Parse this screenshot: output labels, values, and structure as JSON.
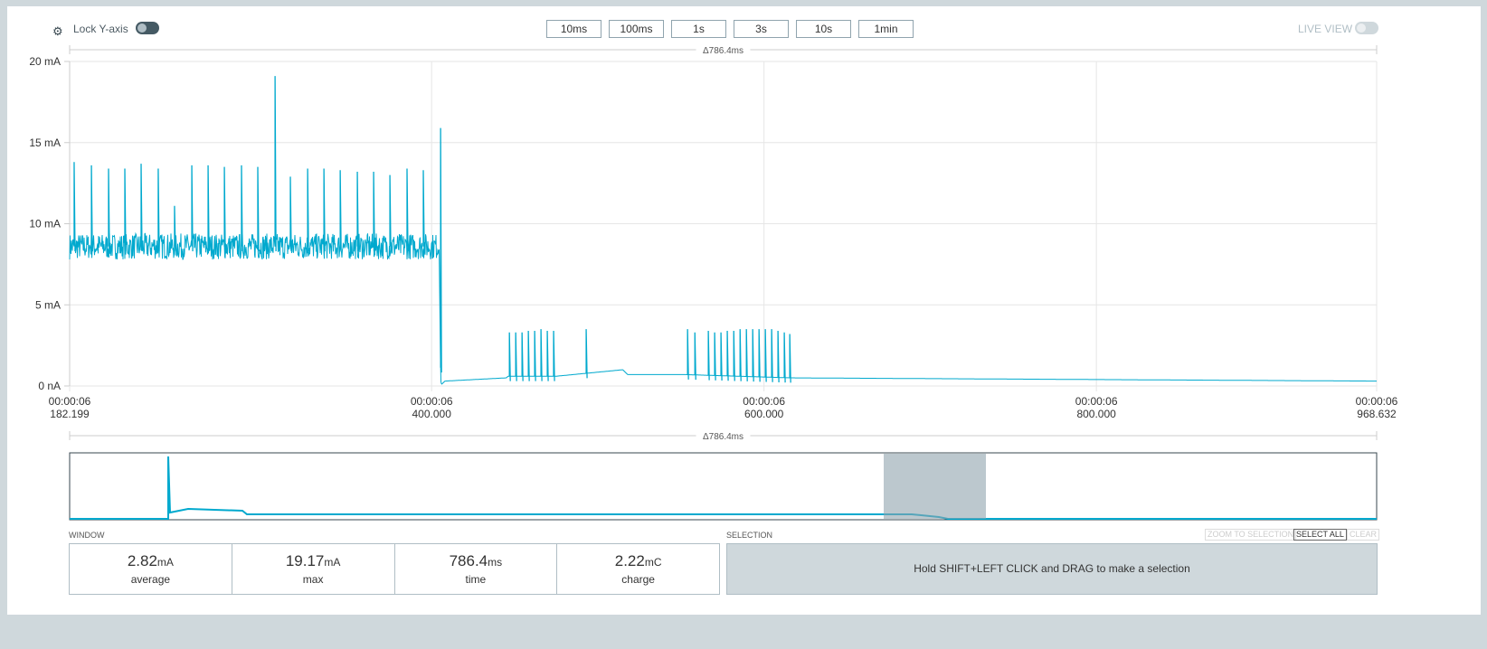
{
  "toolbar": {
    "lock_label": "Lock Y-axis",
    "lock_on": false,
    "live_label": "LIVE VIEW",
    "live_on": false,
    "window_buttons": [
      "10ms",
      "100ms",
      "1s",
      "3s",
      "10s",
      "1min"
    ]
  },
  "chart": {
    "delta_label": "Δ786.4ms"
  },
  "chart_data": {
    "type": "line",
    "color": "#00a9ce",
    "ylim": [
      0,
      20
    ],
    "yticks": [
      "0 nA",
      "5 mA",
      "10 mA",
      "15 mA",
      "20 mA"
    ],
    "ytick_values": [
      0,
      5,
      10,
      15,
      20
    ],
    "xlim": [
      182.199,
      968.632
    ],
    "xticks": [
      {
        "value": 182.199,
        "line1": "00:00:06",
        "line2": "182.199"
      },
      {
        "value": 400,
        "line1": "00:00:06",
        "line2": "400.000"
      },
      {
        "value": 600,
        "line1": "00:00:06",
        "line2": "600.000"
      },
      {
        "value": 800,
        "line1": "00:00:06",
        "line2": "800.000"
      },
      {
        "value": 968.632,
        "line1": "00:00:06",
        "line2": "968.632"
      }
    ],
    "grid": true,
    "baseline_segments": [
      [
        182.199,
        8.6
      ],
      [
        404.5,
        8.6
      ],
      [
        405.5,
        0.3
      ],
      [
        406,
        0.1
      ],
      [
        408,
        0.3
      ],
      [
        445,
        0.5
      ],
      [
        446,
        0.6
      ],
      [
        475,
        0.6
      ],
      [
        515,
        1.0
      ],
      [
        518,
        0.7
      ],
      [
        553,
        0.7
      ],
      [
        616,
        0.5
      ],
      [
        968.632,
        0.3
      ]
    ],
    "spikes": [
      [
        184.9,
        13.8
      ],
      [
        195.3,
        13.6
      ],
      [
        205.6,
        13.4
      ],
      [
        215.4,
        13.4
      ],
      [
        225.2,
        13.7
      ],
      [
        235.5,
        13.4
      ],
      [
        245.3,
        11.1
      ],
      [
        255.7,
        13.6
      ],
      [
        265.5,
        13.6
      ],
      [
        275.3,
        13.5
      ],
      [
        285.6,
        13.6
      ],
      [
        295.4,
        13.5
      ],
      [
        305.8,
        19.1
      ],
      [
        315.0,
        12.9
      ],
      [
        325.4,
        13.4
      ],
      [
        335.2,
        13.4
      ],
      [
        345.0,
        13.3
      ],
      [
        355.3,
        13.2
      ],
      [
        365.1,
        13.2
      ],
      [
        374.9,
        13.0
      ],
      [
        385.2,
        13.4
      ],
      [
        395.0,
        13.3
      ],
      [
        405.4,
        15.9
      ],
      [
        446.8,
        3.3
      ],
      [
        450.6,
        3.3
      ],
      [
        454.4,
        3.3
      ],
      [
        458.2,
        3.4
      ],
      [
        462.0,
        3.4
      ],
      [
        465.8,
        3.5
      ],
      [
        469.6,
        3.4
      ],
      [
        473.4,
        3.4
      ],
      [
        493.0,
        3.5
      ],
      [
        554.0,
        3.5
      ],
      [
        558.4,
        3.3
      ],
      [
        566.5,
        3.4
      ],
      [
        570.3,
        3.3
      ],
      [
        574.1,
        3.3
      ],
      [
        577.9,
        3.4
      ],
      [
        581.8,
        3.4
      ],
      [
        585.6,
        3.5
      ],
      [
        589.4,
        3.5
      ],
      [
        593.2,
        3.5
      ],
      [
        597.0,
        3.5
      ],
      [
        600.8,
        3.5
      ],
      [
        604.6,
        3.5
      ],
      [
        608.4,
        3.4
      ],
      [
        612.2,
        3.3
      ],
      [
        615.5,
        3.2
      ]
    ]
  },
  "window": {
    "title": "WINDOW",
    "stats": [
      {
        "value": "2.82",
        "unit": "mA",
        "label": "average"
      },
      {
        "value": "19.17",
        "unit": "mA",
        "label": "max"
      },
      {
        "value": "786.4",
        "unit": "ms",
        "label": "time"
      },
      {
        "value": "2.22",
        "unit": "mC",
        "label": "charge"
      }
    ]
  },
  "selection": {
    "title": "SELECTION",
    "zoom_label": "ZOOM TO SELECTION",
    "select_all_label": "SELECT ALL",
    "clear_label": "CLEAR",
    "hint": "Hold SHIFT+LEFT CLICK and DRAG to make a selection"
  }
}
